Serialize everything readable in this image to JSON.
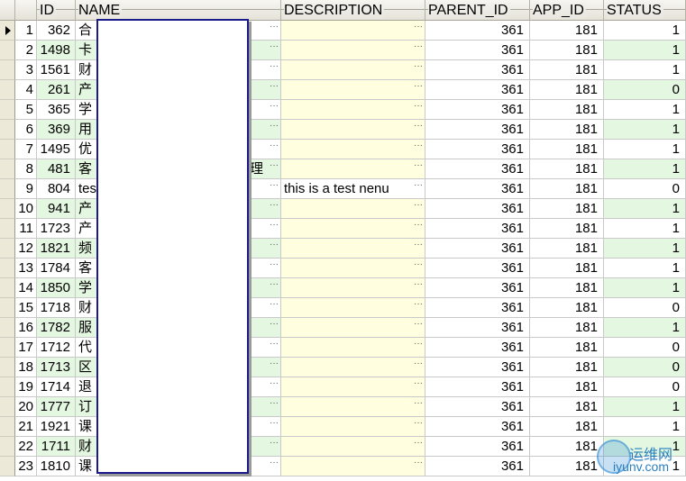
{
  "columns": {
    "id": "ID",
    "name": "NAME",
    "description": "DESCRIPTION",
    "parent_id": "PARENT_ID",
    "app_id": "APP_ID",
    "status": "STATUS"
  },
  "rows": [
    {
      "n": "1",
      "id": "362",
      "name": "合",
      "description": "",
      "parent_id": "361",
      "app_id": "181",
      "status": "1"
    },
    {
      "n": "2",
      "id": "1498",
      "name": "卡",
      "description": "",
      "parent_id": "361",
      "app_id": "181",
      "status": "1"
    },
    {
      "n": "3",
      "id": "1561",
      "name": "财",
      "description": "",
      "parent_id": "361",
      "app_id": "181",
      "status": "1"
    },
    {
      "n": "4",
      "id": "261",
      "name": "产",
      "description": "",
      "parent_id": "361",
      "app_id": "181",
      "status": "0"
    },
    {
      "n": "5",
      "id": "365",
      "name": "学",
      "description": "",
      "parent_id": "361",
      "app_id": "181",
      "status": "1"
    },
    {
      "n": "6",
      "id": "369",
      "name": "用",
      "description": "",
      "parent_id": "361",
      "app_id": "181",
      "status": "1"
    },
    {
      "n": "7",
      "id": "1495",
      "name": "优",
      "description": "",
      "parent_id": "361",
      "app_id": "181",
      "status": "1"
    },
    {
      "n": "8",
      "id": "481",
      "name": "客",
      "description": "",
      "parent_id": "361",
      "app_id": "181",
      "status": "1",
      "name_tail": "理"
    },
    {
      "n": "9",
      "id": "804",
      "name": "tes",
      "description": "this is  a test nenu",
      "parent_id": "361",
      "app_id": "181",
      "status": "0"
    },
    {
      "n": "10",
      "id": "941",
      "name": "产",
      "description": "",
      "parent_id": "361",
      "app_id": "181",
      "status": "1"
    },
    {
      "n": "11",
      "id": "1723",
      "name": "产",
      "description": "",
      "parent_id": "361",
      "app_id": "181",
      "status": "1"
    },
    {
      "n": "12",
      "id": "1821",
      "name": "频",
      "description": "",
      "parent_id": "361",
      "app_id": "181",
      "status": "1"
    },
    {
      "n": "13",
      "id": "1784",
      "name": "客",
      "description": "",
      "parent_id": "361",
      "app_id": "181",
      "status": "1"
    },
    {
      "n": "14",
      "id": "1850",
      "name": "学",
      "description": "",
      "parent_id": "361",
      "app_id": "181",
      "status": "1"
    },
    {
      "n": "15",
      "id": "1718",
      "name": "财",
      "description": "",
      "parent_id": "361",
      "app_id": "181",
      "status": "0"
    },
    {
      "n": "16",
      "id": "1782",
      "name": "服",
      "description": "",
      "parent_id": "361",
      "app_id": "181",
      "status": "1"
    },
    {
      "n": "17",
      "id": "1712",
      "name": "代",
      "description": "",
      "parent_id": "361",
      "app_id": "181",
      "status": "0"
    },
    {
      "n": "18",
      "id": "1713",
      "name": "区",
      "description": "",
      "parent_id": "361",
      "app_id": "181",
      "status": "0"
    },
    {
      "n": "19",
      "id": "1714",
      "name": "退",
      "description": "",
      "parent_id": "361",
      "app_id": "181",
      "status": "0"
    },
    {
      "n": "20",
      "id": "1777",
      "name": "订",
      "description": "",
      "parent_id": "361",
      "app_id": "181",
      "status": "1"
    },
    {
      "n": "21",
      "id": "1921",
      "name": "课",
      "description": "",
      "parent_id": "361",
      "app_id": "181",
      "status": "1"
    },
    {
      "n": "22",
      "id": "1711",
      "name": "财",
      "description": "",
      "parent_id": "361",
      "app_id": "181",
      "status": "1"
    },
    {
      "n": "23",
      "id": "1810",
      "name": "课",
      "description": "",
      "parent_id": "361",
      "app_id": "181",
      "status": "1"
    }
  ],
  "current_row": "1",
  "ellipsis_glyph": "···",
  "watermark": {
    "line1": "运维网",
    "line2": "iyunv.com"
  },
  "colors": {
    "alt_row": "#e4f7e0",
    "description_bg": "#ffffe0",
    "overlay_border": "#1a1a8a"
  }
}
